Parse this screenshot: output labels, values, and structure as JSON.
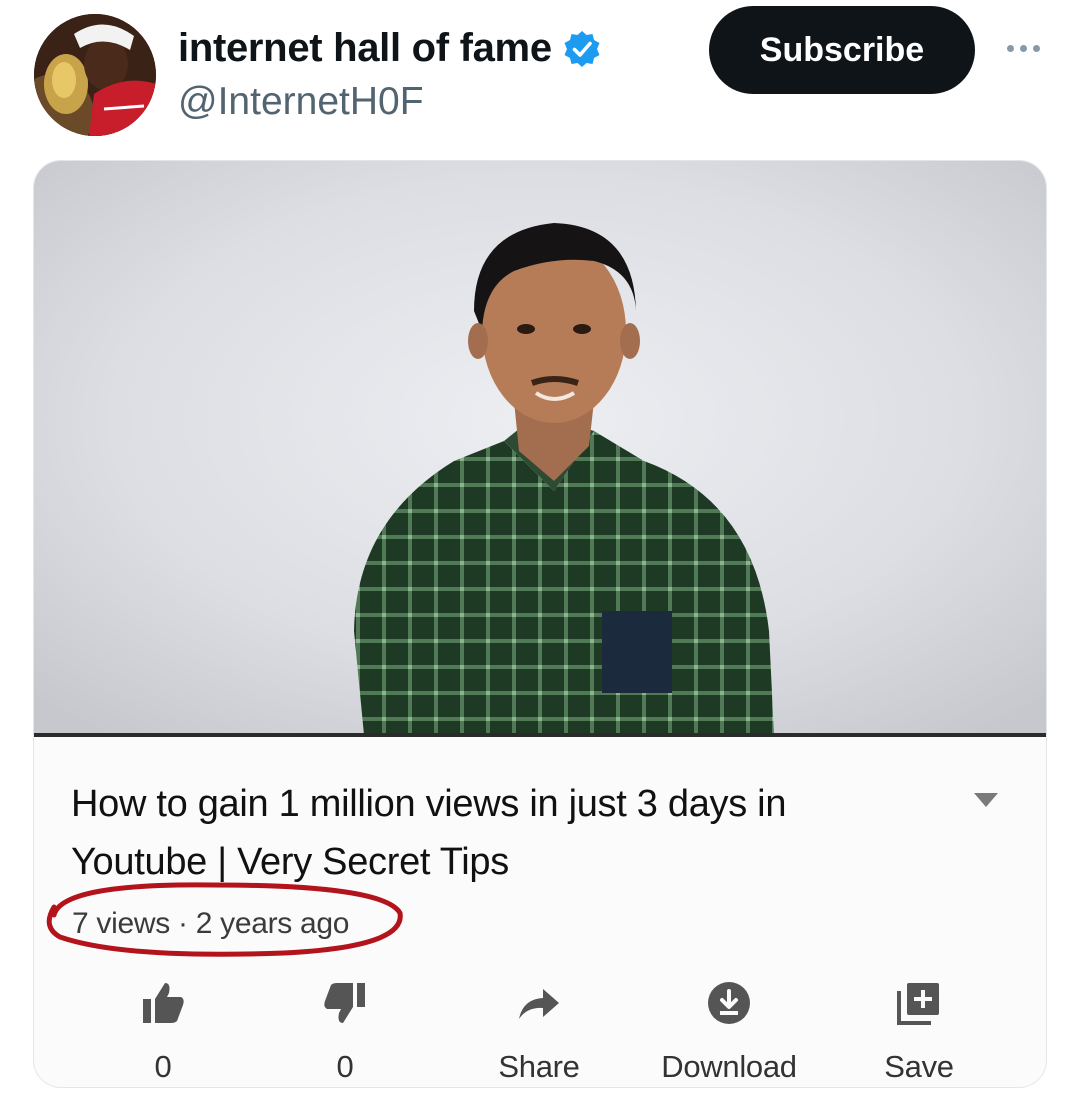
{
  "header": {
    "display_name": "internet hall of fame",
    "handle": "@InternetH0F",
    "subscribe_label": "Subscribe",
    "verified_color": "#1d9bf0"
  },
  "video": {
    "title": "How to gain 1 million views in just 3 days in Youtube | Very Secret Tips",
    "meta": "7 views · 2 years ago",
    "annotation_color": "#b3141c"
  },
  "actions": [
    {
      "icon": "thumbs-up-icon",
      "label": "0"
    },
    {
      "icon": "thumbs-down-icon",
      "label": "0"
    },
    {
      "icon": "share-arrow-icon",
      "label": "Share"
    },
    {
      "icon": "download-icon",
      "label": "Download"
    },
    {
      "icon": "save-playlist-icon",
      "label": "Save"
    }
  ]
}
